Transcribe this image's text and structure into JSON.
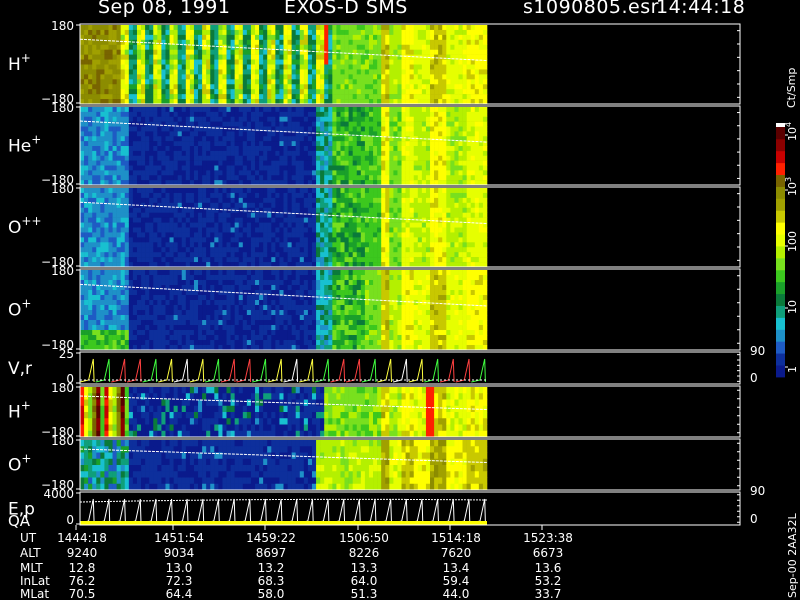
{
  "header": {
    "date": "Sep 08, 1991",
    "title": "EXOS-D SMS",
    "file": "s1090805.esr",
    "time": "14:44:18"
  },
  "side_label": "Sep-00  2AA32L",
  "colors": {
    "background": "#000000",
    "frame": "#ffffff",
    "colormap": [
      "#0a1a8c",
      "#0d2f9c",
      "#1e5bc4",
      "#1e90c8",
      "#18c0d0",
      "#0f9f7a",
      "#0a7a3a",
      "#1aa02a",
      "#3cc81e",
      "#78e01e",
      "#b4f000",
      "#e6ff00",
      "#ffff00",
      "#c8c800",
      "#a0a000",
      "#8c8c00",
      "#786400",
      "#ff2000",
      "#c80000",
      "#8c0000",
      "#5a0000"
    ]
  },
  "colorbar": {
    "unit": "Ct/Smp",
    "tick_labels": [
      "1",
      "10",
      "100",
      "10",
      "10"
    ],
    "tick_exponents": [
      "",
      "",
      "",
      "3",
      "4"
    ]
  },
  "chart_data": {
    "type": "heatmap",
    "x_axis": {
      "ticks": [
        "1444:18",
        "1451:54",
        "1459:22",
        "1506:50",
        "1514:18",
        "1523:38"
      ],
      "rows": [
        {
          "label": "UT",
          "values": [
            "1444:18",
            "1451:54",
            "1459:22",
            "1506:50",
            "1514:18",
            "1523:38"
          ]
        },
        {
          "label": "ALT",
          "values": [
            "9240",
            "9034",
            "8697",
            "8226",
            "7620",
            "6673"
          ]
        },
        {
          "label": "MLT",
          "values": [
            "12.8",
            "13.0",
            "13.2",
            "13.3",
            "13.4",
            "13.6"
          ]
        },
        {
          "label": "InvLat",
          "display": "InLat",
          "values": [
            "76.2",
            "72.3",
            "68.3",
            "64.0",
            "59.4",
            "53.2"
          ]
        },
        {
          "label": "MLat",
          "values": [
            "70.5",
            "64.4",
            "58.0",
            "51.3",
            "44.0",
            "33.7"
          ]
        }
      ]
    },
    "panels": [
      {
        "id": "h-plus-angle",
        "label": "H",
        "charge": "+",
        "ymax": "180",
        "ymin": "−180",
        "series": "pitch-angle spectrogram H+"
      },
      {
        "id": "he-plus-angle",
        "label": "He",
        "charge": "+",
        "ymax": "180",
        "ymin": "−180",
        "series": "pitch-angle spectrogram He+"
      },
      {
        "id": "o-pp-angle",
        "label": "O",
        "charge": "++",
        "ymax": "180",
        "ymin": "−180",
        "series": "pitch-angle spectrogram O++"
      },
      {
        "id": "o-plus-angle",
        "label": "O",
        "charge": "+",
        "ymax": "180",
        "ymin": "−180",
        "series": "pitch-angle spectrogram O+"
      },
      {
        "id": "v-r",
        "label": "V,r",
        "ymax": "25",
        "ymin": "0",
        "right_ticks": [
          "90",
          "0"
        ]
      },
      {
        "id": "h-plus-2",
        "label": "H",
        "charge": "+",
        "ymax": "180",
        "ymin": "−180"
      },
      {
        "id": "o-plus-2",
        "label": "O",
        "charge": "+",
        "ymax": "180",
        "ymin": "−180"
      },
      {
        "id": "e-p-qa",
        "label": "E,p",
        "label2": "QA",
        "ymax": "4000",
        "ymin": "0",
        "right_ticks": [
          "90",
          "0"
        ]
      }
    ]
  }
}
